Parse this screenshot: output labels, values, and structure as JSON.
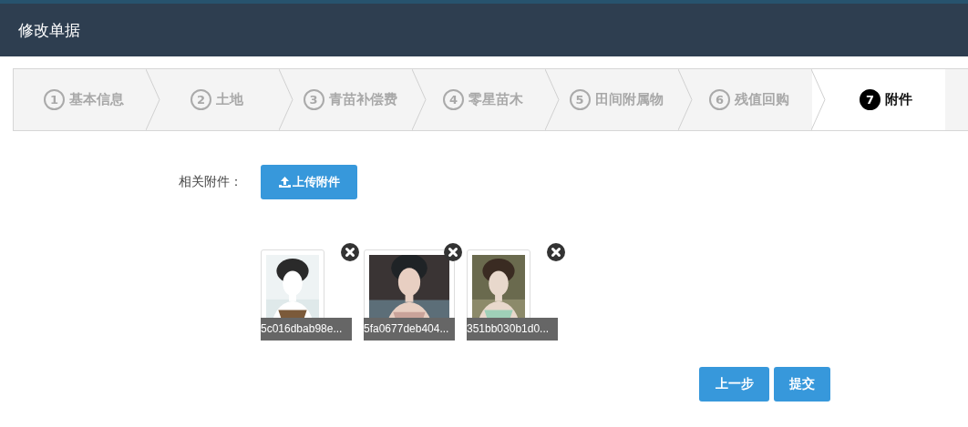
{
  "window": {
    "title": "修改单据"
  },
  "steps": [
    {
      "number": "1",
      "label": "基本信息",
      "selected": false
    },
    {
      "number": "2",
      "label": "土地",
      "selected": false
    },
    {
      "number": "3",
      "label": "青苗补偿费",
      "selected": false
    },
    {
      "number": "4",
      "label": "零星苗木",
      "selected": false
    },
    {
      "number": "5",
      "label": "田间附属物",
      "selected": false
    },
    {
      "number": "6",
      "label": "残值回购",
      "selected": false
    },
    {
      "number": "7",
      "label": "附件",
      "selected": true
    }
  ],
  "attachments": {
    "label": "相关附件：",
    "upload_button": "上传附件",
    "files": [
      {
        "name": "5c016dbab98e...",
        "kind": "picture"
      },
      {
        "name": "5fa0677deb404...",
        "kind": "picture"
      },
      {
        "name": "351bb030b1d0...",
        "kind": "picture"
      }
    ]
  },
  "buttons": [
    "上一步",
    "提交"
  ]
}
